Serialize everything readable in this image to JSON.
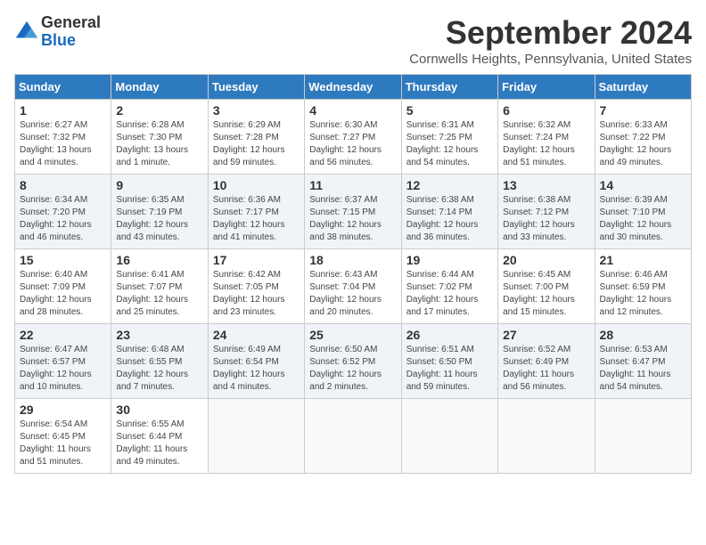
{
  "header": {
    "logo_general": "General",
    "logo_blue": "Blue",
    "month_title": "September 2024",
    "location": "Cornwells Heights, Pennsylvania, United States"
  },
  "days_of_week": [
    "Sunday",
    "Monday",
    "Tuesday",
    "Wednesday",
    "Thursday",
    "Friday",
    "Saturday"
  ],
  "weeks": [
    [
      {
        "day": 1,
        "lines": [
          "Sunrise: 6:27 AM",
          "Sunset: 7:32 PM",
          "Daylight: 13 hours",
          "and 4 minutes."
        ]
      },
      {
        "day": 2,
        "lines": [
          "Sunrise: 6:28 AM",
          "Sunset: 7:30 PM",
          "Daylight: 13 hours",
          "and 1 minute."
        ]
      },
      {
        "day": 3,
        "lines": [
          "Sunrise: 6:29 AM",
          "Sunset: 7:28 PM",
          "Daylight: 12 hours",
          "and 59 minutes."
        ]
      },
      {
        "day": 4,
        "lines": [
          "Sunrise: 6:30 AM",
          "Sunset: 7:27 PM",
          "Daylight: 12 hours",
          "and 56 minutes."
        ]
      },
      {
        "day": 5,
        "lines": [
          "Sunrise: 6:31 AM",
          "Sunset: 7:25 PM",
          "Daylight: 12 hours",
          "and 54 minutes."
        ]
      },
      {
        "day": 6,
        "lines": [
          "Sunrise: 6:32 AM",
          "Sunset: 7:24 PM",
          "Daylight: 12 hours",
          "and 51 minutes."
        ]
      },
      {
        "day": 7,
        "lines": [
          "Sunrise: 6:33 AM",
          "Sunset: 7:22 PM",
          "Daylight: 12 hours",
          "and 49 minutes."
        ]
      }
    ],
    [
      {
        "day": 8,
        "lines": [
          "Sunrise: 6:34 AM",
          "Sunset: 7:20 PM",
          "Daylight: 12 hours",
          "and 46 minutes."
        ]
      },
      {
        "day": 9,
        "lines": [
          "Sunrise: 6:35 AM",
          "Sunset: 7:19 PM",
          "Daylight: 12 hours",
          "and 43 minutes."
        ]
      },
      {
        "day": 10,
        "lines": [
          "Sunrise: 6:36 AM",
          "Sunset: 7:17 PM",
          "Daylight: 12 hours",
          "and 41 minutes."
        ]
      },
      {
        "day": 11,
        "lines": [
          "Sunrise: 6:37 AM",
          "Sunset: 7:15 PM",
          "Daylight: 12 hours",
          "and 38 minutes."
        ]
      },
      {
        "day": 12,
        "lines": [
          "Sunrise: 6:38 AM",
          "Sunset: 7:14 PM",
          "Daylight: 12 hours",
          "and 36 minutes."
        ]
      },
      {
        "day": 13,
        "lines": [
          "Sunrise: 6:38 AM",
          "Sunset: 7:12 PM",
          "Daylight: 12 hours",
          "and 33 minutes."
        ]
      },
      {
        "day": 14,
        "lines": [
          "Sunrise: 6:39 AM",
          "Sunset: 7:10 PM",
          "Daylight: 12 hours",
          "and 30 minutes."
        ]
      }
    ],
    [
      {
        "day": 15,
        "lines": [
          "Sunrise: 6:40 AM",
          "Sunset: 7:09 PM",
          "Daylight: 12 hours",
          "and 28 minutes."
        ]
      },
      {
        "day": 16,
        "lines": [
          "Sunrise: 6:41 AM",
          "Sunset: 7:07 PM",
          "Daylight: 12 hours",
          "and 25 minutes."
        ]
      },
      {
        "day": 17,
        "lines": [
          "Sunrise: 6:42 AM",
          "Sunset: 7:05 PM",
          "Daylight: 12 hours",
          "and 23 minutes."
        ]
      },
      {
        "day": 18,
        "lines": [
          "Sunrise: 6:43 AM",
          "Sunset: 7:04 PM",
          "Daylight: 12 hours",
          "and 20 minutes."
        ]
      },
      {
        "day": 19,
        "lines": [
          "Sunrise: 6:44 AM",
          "Sunset: 7:02 PM",
          "Daylight: 12 hours",
          "and 17 minutes."
        ]
      },
      {
        "day": 20,
        "lines": [
          "Sunrise: 6:45 AM",
          "Sunset: 7:00 PM",
          "Daylight: 12 hours",
          "and 15 minutes."
        ]
      },
      {
        "day": 21,
        "lines": [
          "Sunrise: 6:46 AM",
          "Sunset: 6:59 PM",
          "Daylight: 12 hours",
          "and 12 minutes."
        ]
      }
    ],
    [
      {
        "day": 22,
        "lines": [
          "Sunrise: 6:47 AM",
          "Sunset: 6:57 PM",
          "Daylight: 12 hours",
          "and 10 minutes."
        ]
      },
      {
        "day": 23,
        "lines": [
          "Sunrise: 6:48 AM",
          "Sunset: 6:55 PM",
          "Daylight: 12 hours",
          "and 7 minutes."
        ]
      },
      {
        "day": 24,
        "lines": [
          "Sunrise: 6:49 AM",
          "Sunset: 6:54 PM",
          "Daylight: 12 hours",
          "and 4 minutes."
        ]
      },
      {
        "day": 25,
        "lines": [
          "Sunrise: 6:50 AM",
          "Sunset: 6:52 PM",
          "Daylight: 12 hours",
          "and 2 minutes."
        ]
      },
      {
        "day": 26,
        "lines": [
          "Sunrise: 6:51 AM",
          "Sunset: 6:50 PM",
          "Daylight: 11 hours",
          "and 59 minutes."
        ]
      },
      {
        "day": 27,
        "lines": [
          "Sunrise: 6:52 AM",
          "Sunset: 6:49 PM",
          "Daylight: 11 hours",
          "and 56 minutes."
        ]
      },
      {
        "day": 28,
        "lines": [
          "Sunrise: 6:53 AM",
          "Sunset: 6:47 PM",
          "Daylight: 11 hours",
          "and 54 minutes."
        ]
      }
    ],
    [
      {
        "day": 29,
        "lines": [
          "Sunrise: 6:54 AM",
          "Sunset: 6:45 PM",
          "Daylight: 11 hours",
          "and 51 minutes."
        ]
      },
      {
        "day": 30,
        "lines": [
          "Sunrise: 6:55 AM",
          "Sunset: 6:44 PM",
          "Daylight: 11 hours",
          "and 49 minutes."
        ]
      },
      null,
      null,
      null,
      null,
      null
    ]
  ]
}
